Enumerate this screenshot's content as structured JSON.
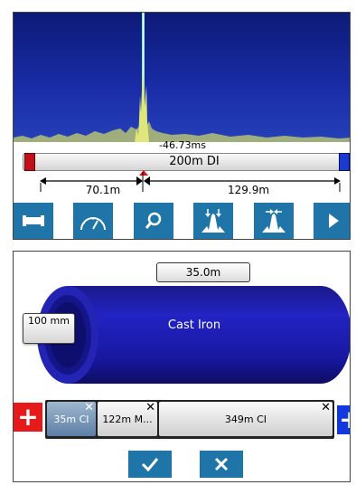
{
  "trace": {
    "delay": "-46.73ms",
    "pipe_label": "200m DI",
    "distance_left": "70.1m",
    "distance_right": "129.9m"
  },
  "toolbar": {
    "buttons": [
      "pipe-icon",
      "gauge-icon",
      "search-icon",
      "filter-narrow-icon",
      "filter-wide-icon",
      "play-icon"
    ]
  },
  "pipe_editor": {
    "length": "35.0m",
    "material": "Cast Iron",
    "diameter": "100 mm",
    "segments": [
      {
        "label": "35m CI",
        "selected": true
      },
      {
        "label": "122m M...",
        "selected": false
      },
      {
        "label": "349m CI",
        "selected": false
      }
    ],
    "add_left": "+",
    "add_right": "+"
  },
  "colors": {
    "accent": "#1f74a8",
    "spectrum_bg": "#1a2da8",
    "pipe_blue": "#1a1aa8",
    "add_red": "#e61a1a",
    "add_blue": "#1238e0"
  }
}
